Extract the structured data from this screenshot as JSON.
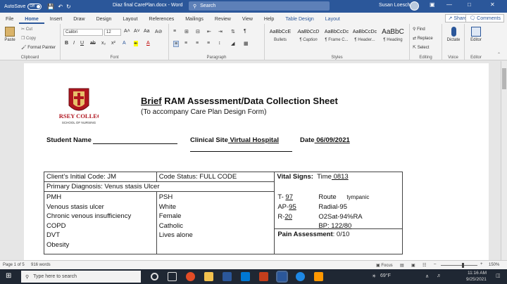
{
  "titlebar": {
    "autosave_label": "AutoSave",
    "autosave_state": "Off",
    "doc_title": "Diaz final CarePlan.docx - Word",
    "search_placeholder": "Search",
    "user_name": "Susan Loesch"
  },
  "tabs": [
    "File",
    "Home",
    "Insert",
    "Draw",
    "Design",
    "Layout",
    "References",
    "Mailings",
    "Review",
    "View",
    "Help",
    "Table Design",
    "Layout"
  ],
  "share_label": "Share",
  "comments_label": "Comments",
  "ribbon": {
    "clipboard": {
      "paste": "Paste",
      "cut": "Cut",
      "copy": "Copy",
      "format_painter": "Format Painter",
      "label": "Clipboard"
    },
    "font": {
      "name": "Calibri",
      "size": "12",
      "label": "Font"
    },
    "paragraph": {
      "label": "Paragraph"
    },
    "styles": {
      "label": "Styles",
      "items": [
        {
          "preview": "AaBbCcE",
          "name": "Bullets"
        },
        {
          "preview": "AaBbCcD",
          "name": "¶ Caption"
        },
        {
          "preview": "AaBbCcDc",
          "name": "¶ Frame C..."
        },
        {
          "preview": "AaBbCcDc",
          "name": "¶ Header..."
        },
        {
          "preview": "AaBbC",
          "name": "¶ Heading"
        }
      ]
    },
    "editing": {
      "find": "Find",
      "replace": "Replace",
      "select": "Select",
      "label": "Editing"
    },
    "voice": {
      "dictate": "Dictate",
      "label": "Voice"
    },
    "editor": {
      "editor": "Editor",
      "label": "Editor"
    }
  },
  "document": {
    "logo_text_1": "JERSEY COLLEGE",
    "logo_text_2": "SCHOOL OF NURSING",
    "title_underlined": "Brief",
    "title_rest": " RAM Assessment/Data Collection Sheet",
    "subtitle": "(To accompany Care Plan Design Form)",
    "student_name_label": "Student Name",
    "clinical_site_label": "Clinical Site",
    "clinical_site_value": " Virtual Hospital",
    "date_label": "Date",
    "date_value": " 06/09/2021",
    "table": {
      "initial_code": "Client’s Initial Code: JM",
      "code_status": "Code Status: FULL CODE",
      "vital_signs_label": "Vital Signs:",
      "time_label": "Time",
      "time_value": " 0813",
      "primary_dx": "Primary Diagnosis: Venus stasis Ulcer",
      "pmh_label": "PMH",
      "pmh_items": [
        "Venous stasis ulcer",
        "Chronic venous insufficiency",
        "COPD",
        "DVT",
        "Obesity"
      ],
      "psh_label": "PSH",
      "psh_items": [
        "White",
        "Female",
        "Catholic",
        "Lives alone"
      ],
      "temp_label": "T- ",
      "temp_value": "97",
      "route_label": "Route",
      "route_value": "tympanic",
      "ap_label": "AP-",
      "ap_value": "95",
      "radial": "Radial-95",
      "r_label": "R-",
      "r_value": "20",
      "o2sat": "O2Sat-94%RA",
      "bp": "BP: 122/80",
      "pain_label": "Pain Assessment",
      "pain_value": ": 0/10"
    }
  },
  "status": {
    "page": "Page 1 of 5",
    "words": "916 words",
    "focus": "Focus",
    "zoom": "150%"
  },
  "taskbar": {
    "search_placeholder": "Type here to search",
    "weather": "69°F",
    "time": "11:16 AM",
    "date": "9/25/2021"
  },
  "colors": {
    "word_blue": "#2b579a",
    "taskbar": "#1f2733",
    "logo_red": "#b0151f"
  }
}
